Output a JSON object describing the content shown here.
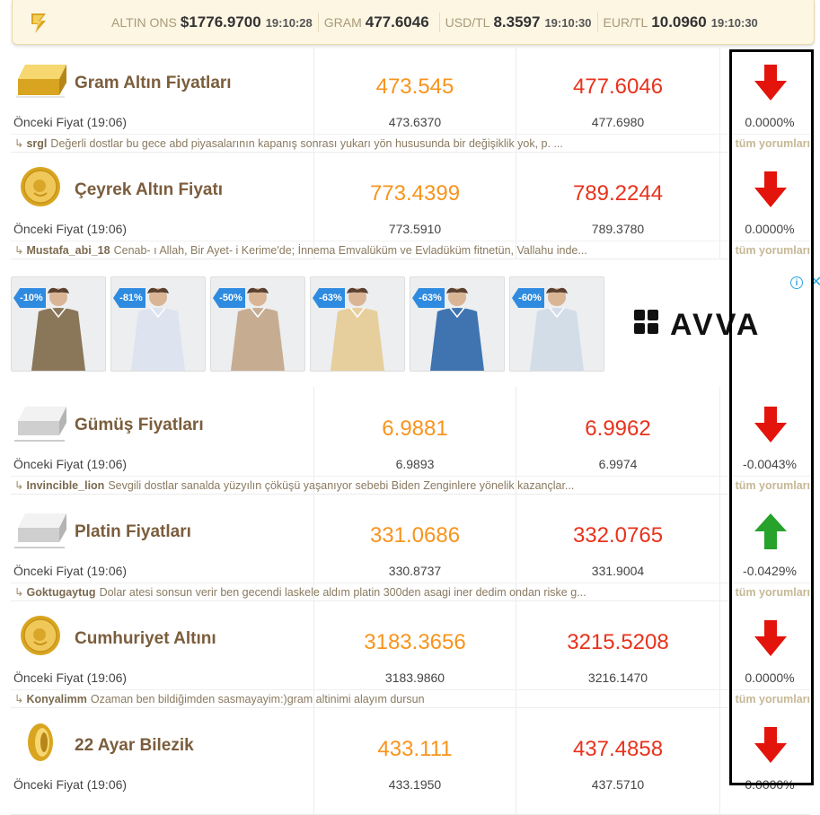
{
  "ticker": [
    {
      "label": "ALTIN ONS",
      "value": "$1776.9700",
      "time": "19:10:28"
    },
    {
      "label": "GRAM",
      "value": "477.6046",
      "time": ""
    },
    {
      "label": "USD/TL",
      "value": "8.3597",
      "time": "19:10:30"
    },
    {
      "label": "EUR/TL",
      "value": "10.0960",
      "time": "19:10:30"
    }
  ],
  "rows": [
    {
      "name": "Gram Altın Fiyatları",
      "icon": "gold-bar-icon",
      "buy": "473.545",
      "sell": "477.6046",
      "prev_label": "Önceki Fiyat (19:06)",
      "prev_buy": "473.6370",
      "prev_sell": "477.6980",
      "pct": "0.0000%",
      "dir": "down",
      "comment_user": "srgl",
      "comment_text": "Değerli dostlar bu gece abd piyasalarının kapanış sonrası yukarı yön hususunda bir değişiklik yok, p. ...",
      "all_label": "tüm yorumları"
    },
    {
      "name": "Çeyrek Altın Fiyatı",
      "icon": "gold-coin-icon",
      "buy": "773.4399",
      "sell": "789.2244",
      "prev_label": "Önceki Fiyat (19:06)",
      "prev_buy": "773.5910",
      "prev_sell": "789.3780",
      "pct": "0.0000%",
      "dir": "down",
      "comment_user": "Mustafa_abi_18",
      "comment_text": "Cenab- ı Allah, Bir Ayet- i Kerime'de; İnnema Emvalüküm ve Evladüküm fitnetün, Vallahu inde...",
      "all_label": "tüm yorumları"
    },
    {
      "name": "Gümüş Fiyatları",
      "icon": "silver-bar-icon",
      "buy": "6.9881",
      "sell": "6.9962",
      "prev_label": "Önceki Fiyat (19:06)",
      "prev_buy": "6.9893",
      "prev_sell": "6.9974",
      "pct": "-0.0043%",
      "dir": "down",
      "comment_user": "Invincible_lion",
      "comment_text": "Sevgili dostlar sanalda yüzyılın çöküşü yaşanıyor sebebi Biden Zenginlere yönelik kazançlar...",
      "all_label": "tüm yorumları"
    },
    {
      "name": "Platin Fiyatları",
      "icon": "platinum-bar-icon",
      "buy": "331.0686",
      "sell": "332.0765",
      "prev_label": "Önceki Fiyat (19:06)",
      "prev_buy": "330.8737",
      "prev_sell": "331.9004",
      "pct": "-0.0429%",
      "dir": "up",
      "comment_user": "Goktugaytug",
      "comment_text": "Dolar atesi sonsun verir ben gecendi laskele aldım platin 300den asagi iner dedim ondan riske g...",
      "all_label": "tüm yorumları"
    },
    {
      "name": "Cumhuriyet Altını",
      "icon": "gold-coin-icon",
      "buy": "3183.3656",
      "sell": "3215.5208",
      "prev_label": "Önceki Fiyat (19:06)",
      "prev_buy": "3183.9860",
      "prev_sell": "3216.1470",
      "pct": "0.0000%",
      "dir": "down",
      "comment_user": "Konyalimm",
      "comment_text": "Ozaman ben bildiğimden sasmayayim:)gram altinimi alayım dursun",
      "all_label": "tüm yorumları"
    },
    {
      "name": "22 Ayar Bilezik",
      "icon": "gold-bracelet-icon",
      "buy": "433.111",
      "sell": "437.4858",
      "prev_label": "Önceki Fiyat (19:06)",
      "prev_buy": "433.1950",
      "prev_sell": "437.5710",
      "pct": "0.0000%",
      "dir": "down",
      "comment_user": "",
      "comment_text": "",
      "all_label": ""
    }
  ],
  "ad": {
    "discounts": [
      "-10%",
      "-81%",
      "-50%",
      "-63%",
      "-63%",
      "-60%"
    ],
    "shirt_colors": [
      "#8a7658",
      "#dde3ef",
      "#c6ad92",
      "#e6cf9c",
      "#3f74b1",
      "#d3dde8"
    ],
    "brand": "AVVA",
    "info_symbol": "i",
    "close_symbol": "✕"
  },
  "colors": {
    "buy": "#f7941d",
    "sell": "#e8321c",
    "down": "#e3140b",
    "up": "#27a22b",
    "name": "#7b5d3c"
  }
}
